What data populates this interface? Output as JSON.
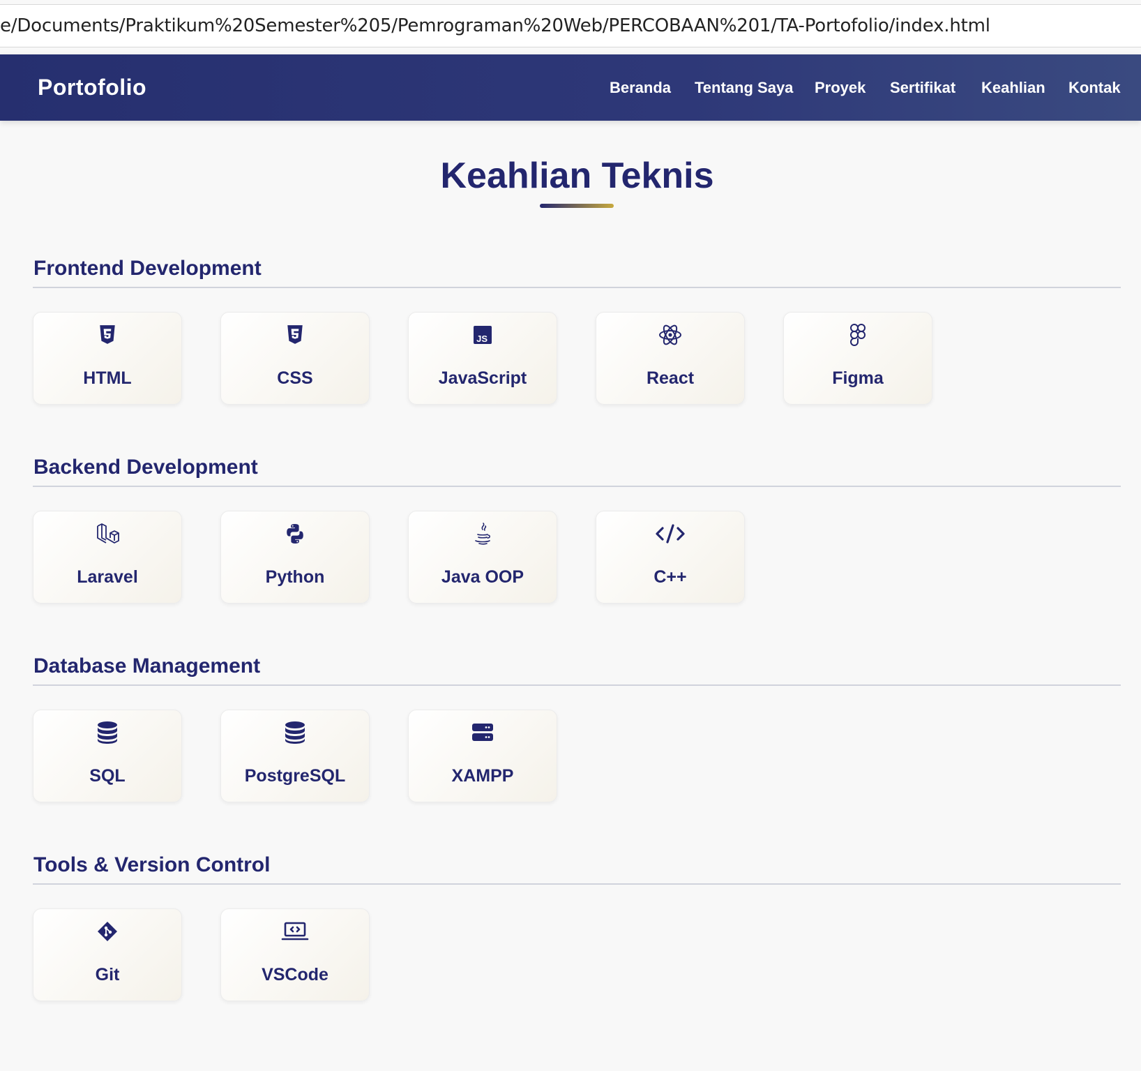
{
  "browser": {
    "url": "e/Documents/Praktikum%20Semester%205/Pemrograman%20Web/PERCOBAAN%201/TA-Portofolio/index.html"
  },
  "navbar": {
    "brand": "Portofolio",
    "links": [
      "Beranda",
      "Tentang Saya",
      "Proyek",
      "Sertifikat",
      "Keahlian",
      "Kontak"
    ]
  },
  "page": {
    "title": "Keahlian Teknis"
  },
  "colors": {
    "primary": "#23266e",
    "accent": "#c7a93e",
    "nav_bg": "#2b3573"
  },
  "categories": [
    {
      "title": "Frontend Development",
      "skills": [
        {
          "label": "HTML",
          "icon": "html5-icon"
        },
        {
          "label": "CSS",
          "icon": "css3-icon"
        },
        {
          "label": "JavaScript",
          "icon": "js-icon"
        },
        {
          "label": "React",
          "icon": "react-icon"
        },
        {
          "label": "Figma",
          "icon": "figma-icon"
        }
      ]
    },
    {
      "title": "Backend Development",
      "skills": [
        {
          "label": "Laravel",
          "icon": "laravel-icon"
        },
        {
          "label": "Python",
          "icon": "python-icon"
        },
        {
          "label": "Java OOP",
          "icon": "java-icon"
        },
        {
          "label": "C++",
          "icon": "code-icon"
        }
      ]
    },
    {
      "title": "Database Management",
      "skills": [
        {
          "label": "SQL",
          "icon": "database-icon"
        },
        {
          "label": "PostgreSQL",
          "icon": "database-icon"
        },
        {
          "label": "XAMPP",
          "icon": "server-icon"
        }
      ]
    },
    {
      "title": "Tools & Version Control",
      "skills": [
        {
          "label": "Git",
          "icon": "git-icon"
        },
        {
          "label": "VSCode",
          "icon": "laptop-code-icon"
        }
      ]
    }
  ]
}
